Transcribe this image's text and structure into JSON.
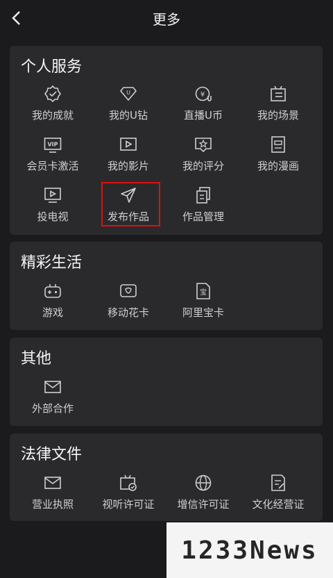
{
  "header": {
    "title": "更多"
  },
  "sections": [
    {
      "title": "个人服务",
      "items": [
        {
          "label": "我的成就",
          "icon": "badge-check-icon"
        },
        {
          "label": "我的U钻",
          "icon": "diamond-icon"
        },
        {
          "label": "直播U币",
          "icon": "coin-icon"
        },
        {
          "label": "我的场景",
          "icon": "scene-icon"
        },
        {
          "label": "会员卡激活",
          "icon": "vip-card-icon"
        },
        {
          "label": "我的影片",
          "icon": "video-icon"
        },
        {
          "label": "我的评分",
          "icon": "rating-icon"
        },
        {
          "label": "我的漫画",
          "icon": "comic-icon"
        },
        {
          "label": "投电视",
          "icon": "tv-cast-icon"
        },
        {
          "label": "发布作品",
          "icon": "paper-plane-icon"
        },
        {
          "label": "作品管理",
          "icon": "copy-icon"
        }
      ]
    },
    {
      "title": "精彩生活",
      "items": [
        {
          "label": "游戏",
          "icon": "gamepad-icon"
        },
        {
          "label": "移动花卡",
          "icon": "flower-card-icon"
        },
        {
          "label": "阿里宝卡",
          "icon": "bao-card-icon"
        }
      ]
    },
    {
      "title": "其他",
      "items": [
        {
          "label": "外部合作",
          "icon": "mail-icon"
        }
      ]
    },
    {
      "title": "法律文件",
      "items": [
        {
          "label": "营业执照",
          "icon": "mail-icon"
        },
        {
          "label": "视听许可证",
          "icon": "tv-license-icon"
        },
        {
          "label": "增信许可证",
          "icon": "globe-icon"
        },
        {
          "label": "文化经营证",
          "icon": "document-icon"
        }
      ]
    }
  ],
  "watermark": {
    "text": "1233News"
  },
  "colors": {
    "background": "#1b1b1d",
    "card": "#2a2a2c",
    "highlight": "#e01010"
  }
}
